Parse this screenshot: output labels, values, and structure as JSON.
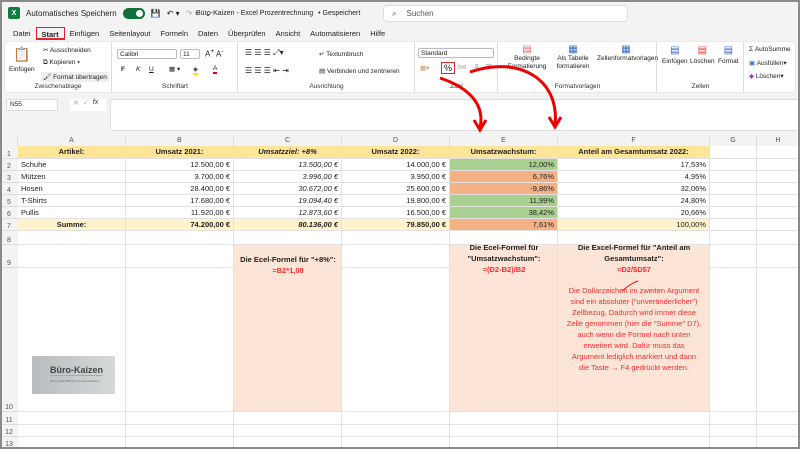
{
  "titlebar": {
    "autosave_label": "Automatisches Speichern",
    "title": "Büro-Kaizen - Excel Prozentrechnung",
    "saved": "• Gespeichert",
    "search_placeholder": "Suchen"
  },
  "tabs": [
    "Datei",
    "Start",
    "Einfügen",
    "Seitenlayout",
    "Formeln",
    "Daten",
    "Überprüfen",
    "Ansicht",
    "Automatisieren",
    "Hilfe"
  ],
  "active_tab": "Start",
  "ribbon": {
    "clipboard": {
      "paste": "Einfügen",
      "cut": "Ausschneiden",
      "copy": "Kopieren",
      "format_painter": "Format übertragen",
      "label": "Zwischenablage"
    },
    "font": {
      "name": "Calibri",
      "size": "11",
      "bold": "F",
      "italic": "K",
      "underline": "U",
      "label": "Schriftart"
    },
    "alignment": {
      "wrap": "Textumbruch",
      "merge": "Verbinden und zentrieren",
      "label": "Ausrichtung"
    },
    "number": {
      "format": "Standard",
      "percent": "%",
      "thousands": "000",
      "label": "Zahl"
    },
    "styles": {
      "conditional": "Bedingte Formatierung",
      "as_table": "Als Tabelle formatieren",
      "cell_styles": "Zellenformatvorlagen",
      "label": "Formatvorlagen"
    },
    "cells": {
      "insert": "Einfügen",
      "delete": "Löschen",
      "format": "Format",
      "label": "Zellen"
    },
    "editing": {
      "autosum": "AutoSumme",
      "fill": "Ausfüllen",
      "clear": "Löschen"
    }
  },
  "formula_bar": {
    "name_box": "N55",
    "fx": "fx",
    "value": ""
  },
  "columns": [
    "A",
    "B",
    "C",
    "D",
    "E",
    "F",
    "G",
    "H"
  ],
  "rows": [
    "1",
    "2",
    "3",
    "4",
    "5",
    "6",
    "7",
    "8",
    "9",
    "10",
    "11",
    "12",
    "13"
  ],
  "table": {
    "headers": [
      "Artikel:",
      "Umsatz 2021:",
      "Umsatzziel: +8%",
      "Umsatz 2022:",
      "Umsatzwachstum:",
      "Anteil am Gesamtumsatz 2022:"
    ],
    "data": [
      [
        "Schuhe",
        "12.500,00 €",
        "13.500,00 €",
        "14.000,00 €",
        "12,00%",
        "17,53%"
      ],
      [
        "Mützen",
        "3.700,00 €",
        "3.996,00 €",
        "3.950,00 €",
        "6,76%",
        "4,95%"
      ],
      [
        "Hosen",
        "28.400,00 €",
        "30.672,00 €",
        "25.600,00 €",
        "-9,86%",
        "32,06%"
      ],
      [
        "T-Shirts",
        "17.680,00 €",
        "19.094,40 €",
        "19.800,00 €",
        "11,99%",
        "24,80%"
      ],
      [
        "Pullis",
        "11.920,00 €",
        "12.873,60 €",
        "16.500,00 €",
        "38,42%",
        "20,66%"
      ]
    ],
    "total": [
      "Summe:",
      "74.200,00 €",
      "80.136,00 €",
      "79.850,00 €",
      "7,61%",
      "100,00%"
    ],
    "growth_status": [
      "green",
      "orange",
      "orange",
      "green",
      "green",
      "orange"
    ]
  },
  "notes": {
    "c_title": "Die Ecel-Formel für \"+8%\":",
    "c_formula": "=B2*1,08",
    "e_title1": "Die Ecel-Formel für",
    "e_title2": "\"Umsatzwachstum\":",
    "e_formula": "=(D2-B2)/B2",
    "f_title1": "Die Excel-Formel für \"Anteil am",
    "f_title2": "Gesamtumsatz\":",
    "f_formula": "=D2/$D$7",
    "f_explain": [
      "Die Dollarzeichen im zweiten Argument",
      "sind ein absoluter (\"unveränderlicher\")",
      "Zellbezug. Dadurch wird immer diese",
      "Zelle genommen (hier die \"Summe\" D7),",
      "auch wenn die Formel nach unten",
      "erweitert wird. Dafür muss das",
      "Argument lediglich markiert und dann",
      "die Taste → F4 gedrückt werden."
    ]
  },
  "logo": {
    "name": "Büro-Kaizen",
    "tagline": "20 % mehr Effizienz im Unternehmen"
  },
  "colors": {
    "header": "#ffe59a",
    "sum": "#fff2cc",
    "green": "#a9d08e",
    "orange": "#f4b183",
    "note_bg": "#fce4d6",
    "annotation_red": "#f03030"
  }
}
